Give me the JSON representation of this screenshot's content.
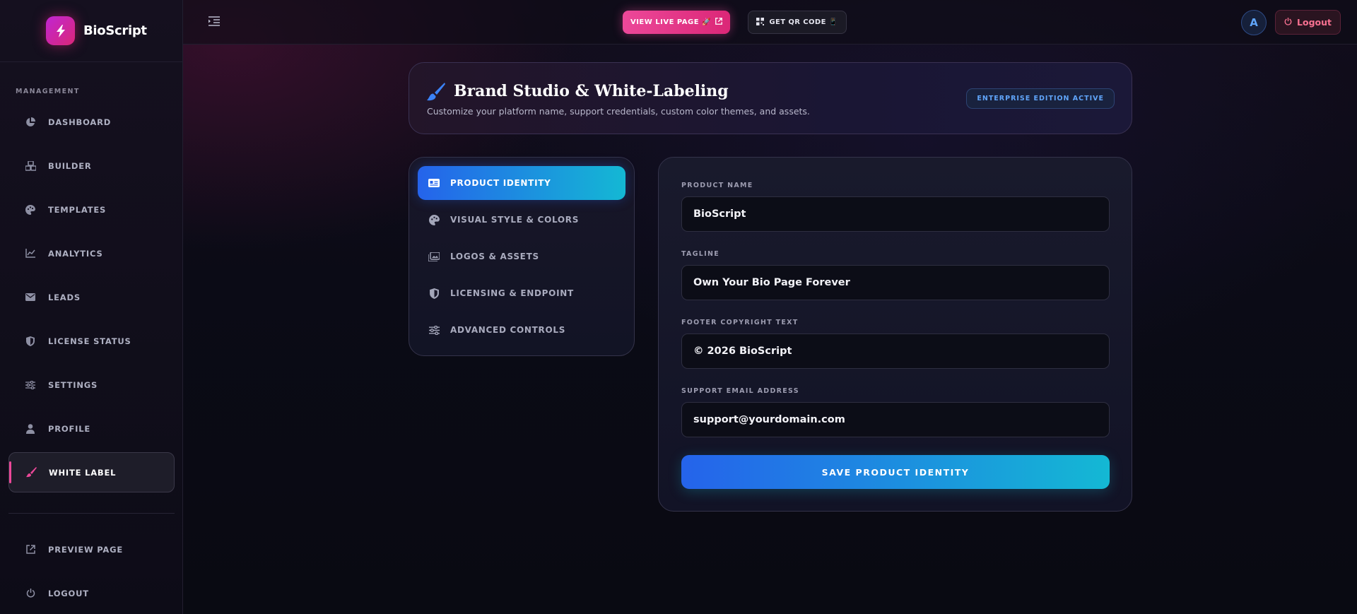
{
  "brand": {
    "name": "BioScript",
    "logo_icon": "bolt-icon"
  },
  "sidebar": {
    "section_label": "MANAGEMENT",
    "items": [
      {
        "label": "DASHBOARD",
        "icon": "pie-chart-icon"
      },
      {
        "label": "BUILDER",
        "icon": "cubes-icon"
      },
      {
        "label": "TEMPLATES",
        "icon": "palette-icon"
      },
      {
        "label": "ANALYTICS",
        "icon": "line-chart-icon"
      },
      {
        "label": "LEADS",
        "icon": "envelope-icon"
      },
      {
        "label": "LICENSE STATUS",
        "icon": "shield-icon"
      },
      {
        "label": "SETTINGS",
        "icon": "sliders-icon"
      },
      {
        "label": "PROFILE",
        "icon": "user-icon"
      },
      {
        "label": "WHITE LABEL",
        "icon": "brush-icon",
        "active": true
      }
    ],
    "bottom_items": [
      {
        "label": "PREVIEW PAGE",
        "icon": "external-link-icon"
      },
      {
        "label": "LOGOUT",
        "icon": "power-icon"
      }
    ]
  },
  "topbar": {
    "view_live_label": "VIEW LIVE PAGE 🚀",
    "qr_label": "GET QR CODE 📱",
    "avatar_initial": "A",
    "logout_label": "Logout"
  },
  "header": {
    "title": "Brand Studio & White-Labeling",
    "subtitle": "Customize your platform name, support credentials, custom color themes, and assets.",
    "badge": "ENTERPRISE EDITION ACTIVE"
  },
  "tabs": [
    {
      "label": "PRODUCT IDENTITY",
      "icon": "id-card-icon",
      "active": true
    },
    {
      "label": "VISUAL STYLE & COLORS",
      "icon": "palette-icon"
    },
    {
      "label": "LOGOS & ASSETS",
      "icon": "images-icon"
    },
    {
      "label": "LICENSING & ENDPOINT",
      "icon": "shield-icon"
    },
    {
      "label": "ADVANCED CONTROLS",
      "icon": "sliders-icon"
    }
  ],
  "form": {
    "product_name": {
      "label": "PRODUCT NAME",
      "value": "BioScript"
    },
    "tagline": {
      "label": "TAGLINE",
      "value": "Own Your Bio Page Forever"
    },
    "footer": {
      "label": "FOOTER COPYRIGHT TEXT",
      "value": "© 2026 BioScript"
    },
    "support_email": {
      "label": "SUPPORT EMAIL ADDRESS",
      "value": "support@yourdomain.com"
    },
    "save_label": "SAVE PRODUCT IDENTITY"
  },
  "colors": {
    "accent_pink": "#ec4899",
    "accent_blue": "#2563eb",
    "accent_cyan": "#14b8d4",
    "badge_blue": "#60a5fa"
  }
}
